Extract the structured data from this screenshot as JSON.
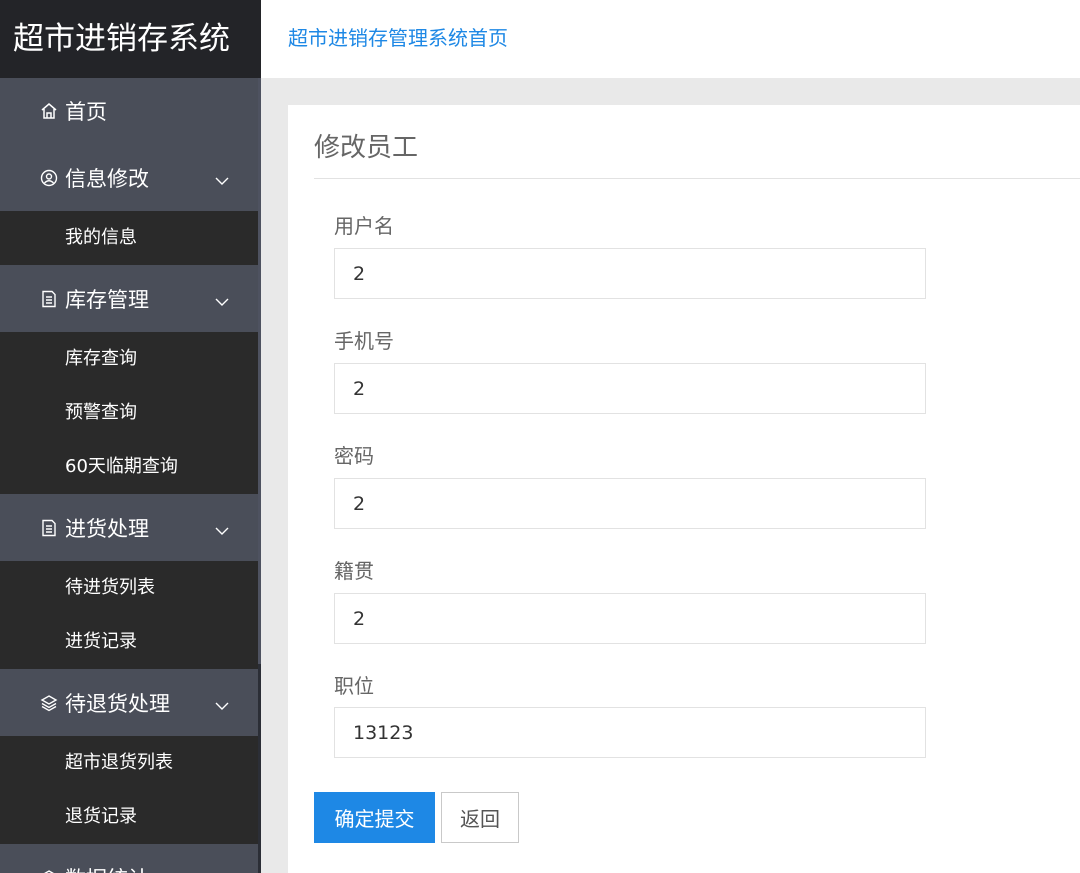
{
  "app": {
    "logo": "超市进销存系统"
  },
  "header": {
    "home_link": "超市进销存管理系统首页"
  },
  "nav": {
    "home": {
      "label": "首页",
      "icon": "home-icon"
    },
    "info": {
      "label": "信息修改",
      "icon": "user-circle-icon",
      "items": [
        "我的信息"
      ]
    },
    "stock": {
      "label": "库存管理",
      "icon": "document-icon",
      "items": [
        "库存查询",
        "预警查询",
        "60天临期查询"
      ]
    },
    "purchase": {
      "label": "进货处理",
      "icon": "document-icon",
      "items": [
        "待进货列表",
        "进货记录"
      ]
    },
    "returns": {
      "label": "待退货处理",
      "icon": "layers-icon",
      "items": [
        "超市退货列表",
        "退货记录"
      ]
    },
    "stats": {
      "label": "数据统计",
      "icon": "chart-icon"
    }
  },
  "form": {
    "title": "修改员工",
    "fields": [
      {
        "label": "用户名",
        "value": "2"
      },
      {
        "label": "手机号",
        "value": "2"
      },
      {
        "label": "密码",
        "value": "2"
      },
      {
        "label": "籍贯",
        "value": "2"
      },
      {
        "label": "职位",
        "value": "13123"
      }
    ],
    "submit_label": "确定提交",
    "back_label": "返回"
  },
  "colors": {
    "accent": "#1e88e5",
    "sidebar_bg": "#393d49",
    "sidebar_header": "#4a4e59",
    "submenu_bg": "#2a2a2a",
    "logo_bg": "#232428"
  }
}
